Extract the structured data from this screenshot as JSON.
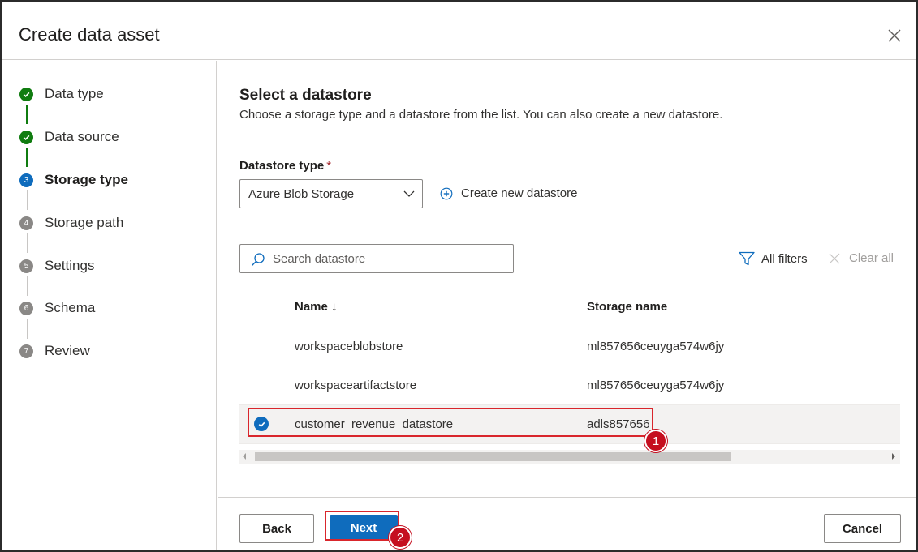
{
  "dialog": {
    "title": "Create data asset",
    "close_icon": "close-icon"
  },
  "steps": [
    {
      "number": "",
      "label": "Data type",
      "status": "done"
    },
    {
      "number": "",
      "label": "Data source",
      "status": "done"
    },
    {
      "number": "3",
      "label": "Storage type",
      "status": "current"
    },
    {
      "number": "4",
      "label": "Storage path",
      "status": "todo"
    },
    {
      "number": "5",
      "label": "Settings",
      "status": "todo"
    },
    {
      "number": "6",
      "label": "Schema",
      "status": "todo"
    },
    {
      "number": "7",
      "label": "Review",
      "status": "todo"
    }
  ],
  "main": {
    "title": "Select a datastore",
    "description": "Choose a storage type and a datastore from the list. You can also create a new datastore.",
    "datastore_type": {
      "label": "Datastore type",
      "required_mark": "*",
      "selected": "Azure Blob Storage"
    },
    "create_link": "Create new datastore",
    "search": {
      "placeholder": "Search datastore",
      "value": ""
    },
    "all_filters": "All filters",
    "clear_all": "Clear all",
    "table": {
      "columns": [
        "Name ↓",
        "Storage name"
      ],
      "rows": [
        {
          "name": "workspaceblobstore",
          "storage": "ml857656ceuyga574w6jy",
          "selected": false
        },
        {
          "name": "workspaceartifactstore",
          "storage": "ml857656ceuyga574w6jy",
          "selected": false
        },
        {
          "name": "customer_revenue_datastore",
          "storage": "adls857656",
          "selected": true
        }
      ]
    }
  },
  "footer": {
    "back": "Back",
    "next": "Next",
    "cancel": "Cancel"
  },
  "annotations": {
    "badge1": "1",
    "badge2": "2",
    "highlight_color": "#d9262c"
  },
  "colors": {
    "accent": "#0f6cbd",
    "success": "#107c10",
    "pending": "#8a8886"
  }
}
